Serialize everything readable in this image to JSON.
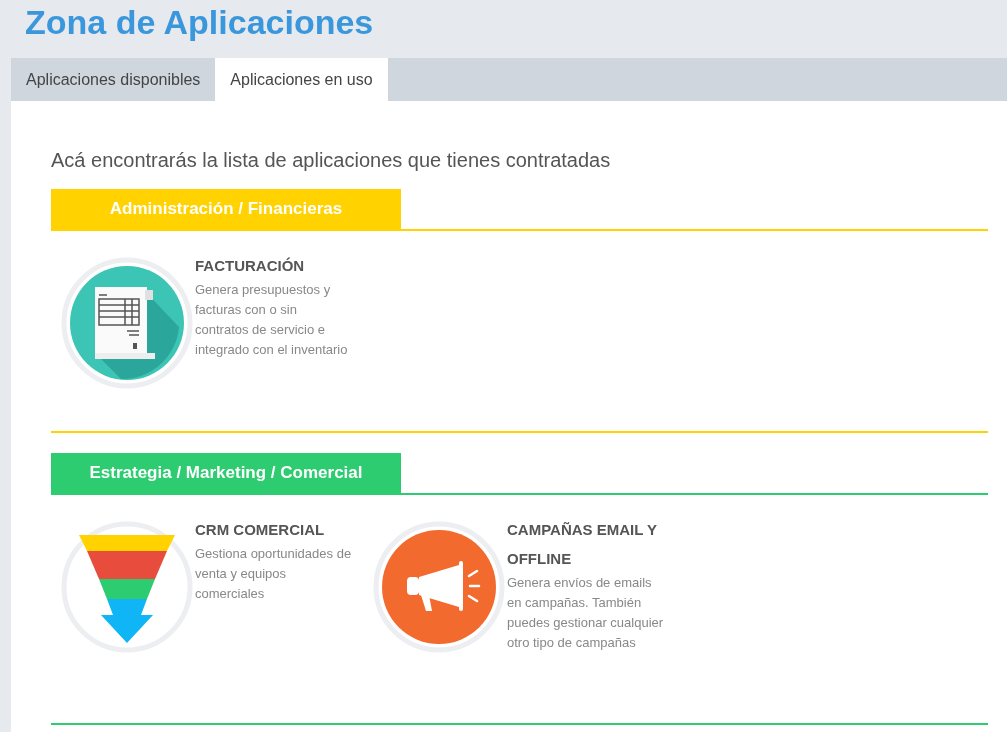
{
  "page_title": "Zona de Aplicaciones",
  "tabs": [
    {
      "label": "Aplicaciones disponibles",
      "selected": false
    },
    {
      "label": "Aplicaciones en uso",
      "selected": true
    }
  ],
  "intro": "Acá encontrarás la lista de aplicaciones que tienes contratadas",
  "categories": [
    {
      "title": "Administración / Financieras",
      "color": "#ffd200",
      "apps": [
        {
          "kind": "invoice",
          "name": "FACTURACIÓN",
          "description": "Genera presupuestos y facturas con o sin contratos de servicio e integrado con el inventario"
        }
      ]
    },
    {
      "title": "Estrategia / Marketing / Comercial",
      "color": "#2ecc71",
      "apps": [
        {
          "kind": "funnel",
          "name": "CRM COMERCIAL",
          "description": "Gestiona oportunidades de venta y equipos comerciales"
        },
        {
          "kind": "megaphone",
          "name": "CAMPAÑAS EMAIL Y OFFLINE",
          "description": "Genera envíos de emails en campañas. También puedes gestionar cualquier otro tipo de campañas"
        }
      ]
    }
  ]
}
